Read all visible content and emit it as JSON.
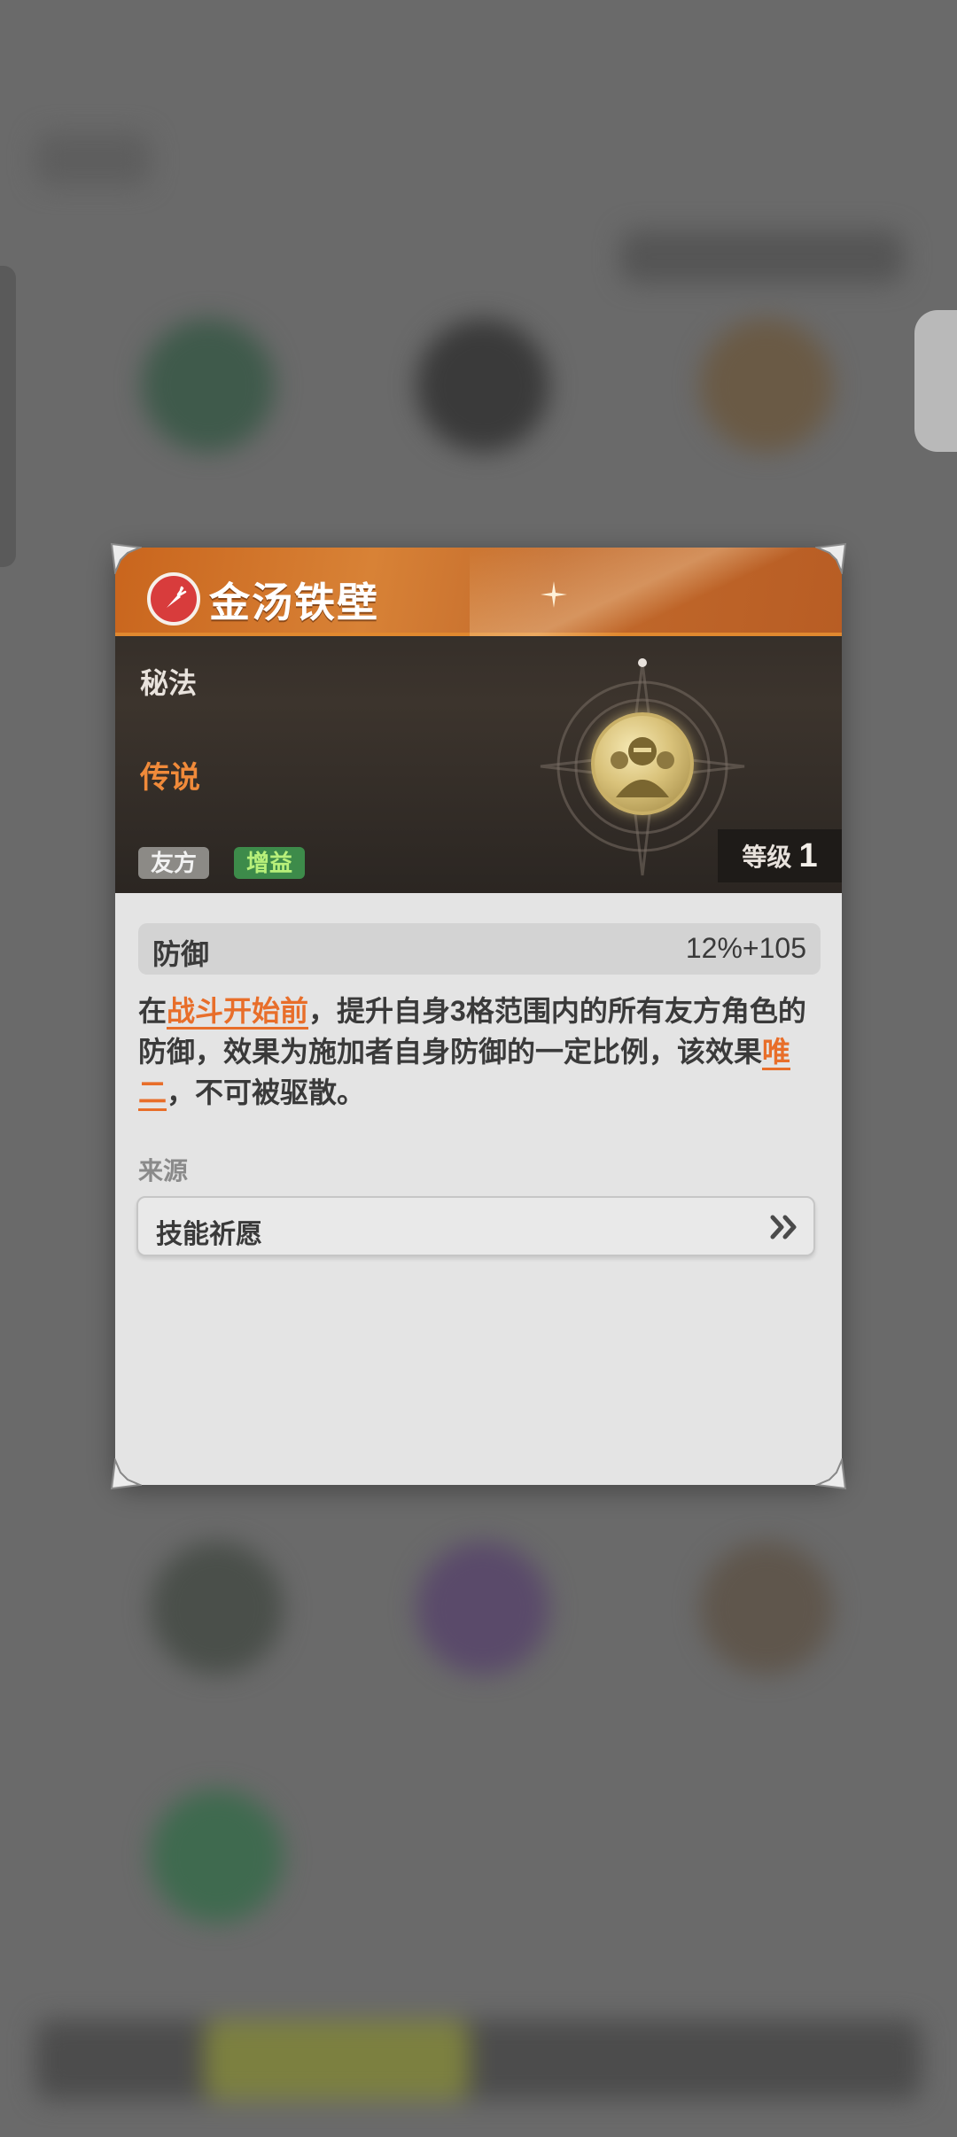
{
  "card": {
    "title": "金汤铁壁",
    "category": "秘法",
    "rarity": "传说",
    "tags": [
      "友方",
      "增益"
    ],
    "level_label": "等级",
    "level_value": "1",
    "stat": {
      "name": "防御",
      "value": "12%+105"
    },
    "description": {
      "part1": "在",
      "highlight1": "战斗开始前",
      "part2": "，提升自身3格范围内的所有友方角色的防御，效果为施加者自身防御的一定比例，该效果",
      "highlight2": "唯二",
      "part3": "，不可被驱散。"
    },
    "source_label": "来源",
    "source_value": "技能祈愿"
  },
  "colors": {
    "accent_orange": "#e86e2a",
    "title_bar": "#c9651d",
    "buff_tag": "#3d8b4a",
    "friendly_tag": "#8c8a86"
  },
  "icons": {
    "skill": "carrot-icon",
    "emblem": "guardians-emblem-icon",
    "source_arrow": "double-chevron-right-icon"
  }
}
